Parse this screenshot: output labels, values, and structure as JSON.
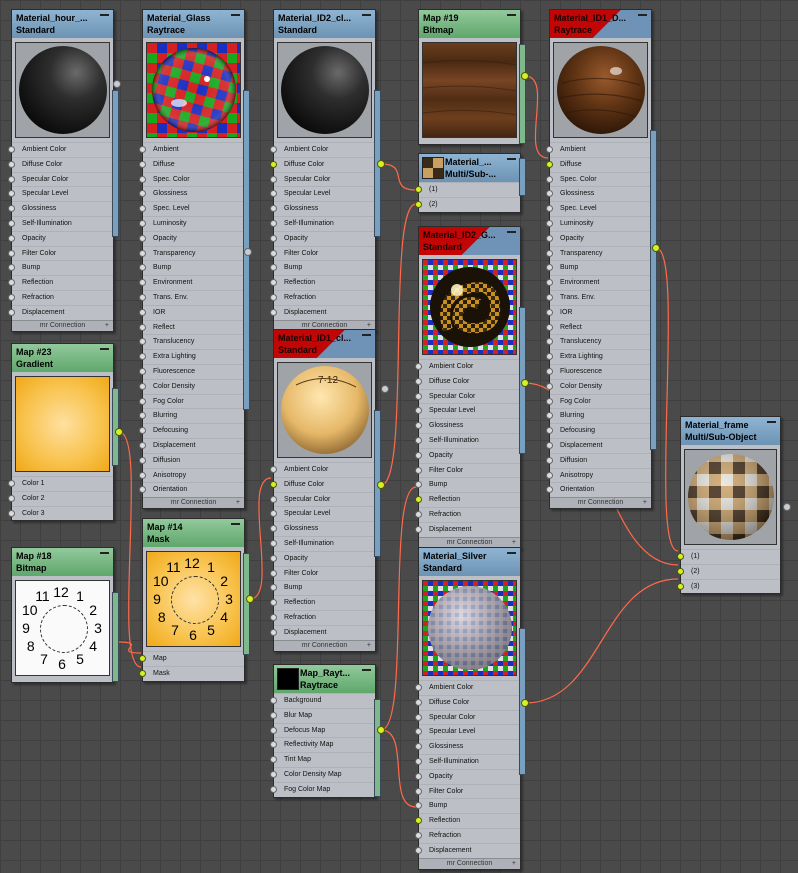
{
  "nodes": {
    "mat_hour": {
      "title": "Material_hour_...",
      "type": "Standard",
      "slots": [
        "Ambient Color",
        "Diffuse Color",
        "Specular Color",
        "Specular Level",
        "Glossiness",
        "Self-Illumination",
        "Opacity",
        "Filter Color",
        "Bump",
        "Reflection",
        "Refraction",
        "Displacement"
      ],
      "footer": "mr Connection"
    },
    "mat_glass": {
      "title": "Material_Glass",
      "type": "Raytrace",
      "slots": [
        "Ambient",
        "Diffuse",
        "Spec. Color",
        "Glossiness",
        "Spec. Level",
        "Luminosity",
        "Opacity",
        "Transparency",
        "Bump",
        "Environment",
        "Trans. Env.",
        "IOR",
        "Reflect",
        "Translucency",
        "Extra Lighting",
        "Fluorescence",
        "Color Density",
        "Fog Color",
        "Blurring",
        "Defocusing",
        "Displacement",
        "Diffusion",
        "Anisotropy",
        "Orientation"
      ],
      "footer": "mr Connection"
    },
    "mat_id2_cl": {
      "title": "Material_ID2_cl...",
      "type": "Standard",
      "slots": [
        "Ambient Color",
        "Diffuse Color",
        "Specular Color",
        "Specular Level",
        "Glossiness",
        "Self-Illumination",
        "Opacity",
        "Filter Color",
        "Bump",
        "Reflection",
        "Refraction",
        "Displacement"
      ],
      "footer": "mr Connection"
    },
    "map19": {
      "title": "Map #19",
      "type": "Bitmap"
    },
    "mat_id1_d": {
      "title": "Material_ID1_D...",
      "type": "Raytrace",
      "slots": [
        "Ambient",
        "Diffuse",
        "Spec. Color",
        "Glossiness",
        "Spec. Level",
        "Luminosity",
        "Opacity",
        "Transparency",
        "Bump",
        "Environment",
        "Trans. Env.",
        "IOR",
        "Reflect",
        "Translucency",
        "Extra Lighting",
        "Fluorescence",
        "Color Density",
        "Fog Color",
        "Blurring",
        "Defocusing",
        "Displacement",
        "Diffusion",
        "Anisotropy",
        "Orientation"
      ],
      "footer": "mr Connection"
    },
    "multi_sub": {
      "title": "Material_...",
      "type": "Multi/Sub-...",
      "slots": [
        "(1)",
        "(2)"
      ]
    },
    "mat_id2_g": {
      "title": "Material_ID2_G...",
      "type": "Standard",
      "slots": [
        "Ambient Color",
        "Diffuse Color",
        "Specular Color",
        "Specular Level",
        "Glossiness",
        "Self-Illumination",
        "Opacity",
        "Filter Color",
        "Bump",
        "Reflection",
        "Refraction",
        "Displacement"
      ],
      "footer": "mr Connection"
    },
    "map23": {
      "title": "Map #23",
      "type": "Gradient",
      "slots": [
        "Color 1",
        "Color 2",
        "Color 3"
      ]
    },
    "mat_id1_cl": {
      "title": "Material_ID1_cl...",
      "type": "Standard",
      "slots": [
        "Ambient Color",
        "Diffuse Color",
        "Specular Color",
        "Specular Level",
        "Glossiness",
        "Self-Illumination",
        "Opacity",
        "Filter Color",
        "Bump",
        "Reflection",
        "Refraction",
        "Displacement"
      ],
      "footer": "mr Connection"
    },
    "mat_frame": {
      "title": "Material_frame",
      "type": "Multi/Sub-Object",
      "slots": [
        "(1)",
        "(2)",
        "(3)"
      ]
    },
    "map14": {
      "title": "Map #14",
      "type": "Mask",
      "slots": [
        "Map",
        "Mask"
      ]
    },
    "map18": {
      "title": "Map #18",
      "type": "Bitmap"
    },
    "mat_silver": {
      "title": "Material_Silver",
      "type": "Standard",
      "slots": [
        "Ambient Color",
        "Diffuse Color",
        "Specular Color",
        "Specular Level",
        "Glossiness",
        "Self-Illumination",
        "Opacity",
        "Filter Color",
        "Bump",
        "Reflection",
        "Refraction",
        "Displacement"
      ],
      "footer": "mr Connection"
    },
    "map_rayt": {
      "title": "Map_Rayt...",
      "type": "Raytrace",
      "slots": [
        "Background",
        "Blur Map",
        "Defocus Map",
        "Reflectivity Map",
        "Tint Map",
        "Color Density Map",
        "Fog Color Map"
      ]
    }
  },
  "clock_numbers": [
    "12",
    "1",
    "2",
    "3",
    "4",
    "5",
    "6",
    "7",
    "8",
    "9",
    "10",
    "11"
  ],
  "ball_marks": "7·12",
  "colors": {
    "background": "#4a4a4a",
    "header_material": "#7fa4c4",
    "header_map": "#7dbb88",
    "header_active": "#c20606",
    "wire": "#ff6a4a",
    "socket_on": "#d8ee2c"
  }
}
